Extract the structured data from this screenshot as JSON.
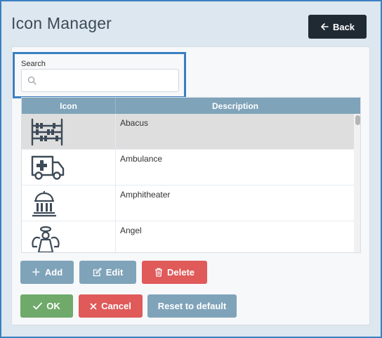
{
  "window": {
    "title": "Icon Manager"
  },
  "header": {
    "back_label": "Back"
  },
  "search": {
    "label": "Search",
    "placeholder": "",
    "value": ""
  },
  "table": {
    "columns": [
      "Icon",
      "Description"
    ],
    "rows": [
      {
        "icon": "abacus-icon",
        "description": "Abacus",
        "selected": true
      },
      {
        "icon": "ambulance-icon",
        "description": "Ambulance",
        "selected": false
      },
      {
        "icon": "amphitheater-icon",
        "description": "Amphitheater",
        "selected": false
      },
      {
        "icon": "angel-icon",
        "description": "Angel",
        "selected": false
      }
    ]
  },
  "actions": {
    "add_label": "Add",
    "edit_label": "Edit",
    "delete_label": "Delete"
  },
  "footer": {
    "ok_label": "OK",
    "cancel_label": "Cancel",
    "reset_label": "Reset to default"
  },
  "colors": {
    "accent": "#3a7fc1",
    "header": "#7fa3b9",
    "danger": "#e05a5a",
    "success": "#6faa6a",
    "dark": "#1f2a33"
  }
}
